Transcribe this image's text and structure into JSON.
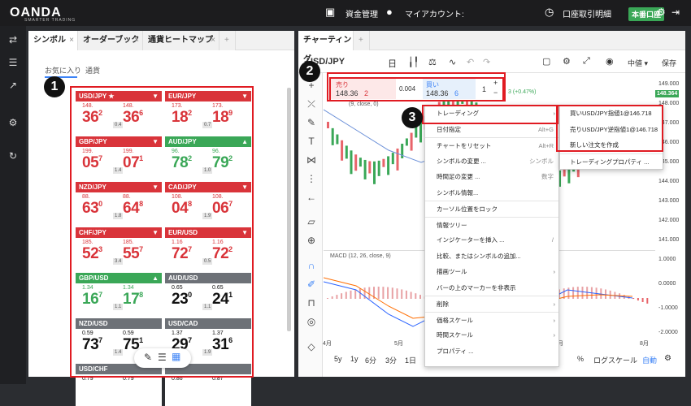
{
  "app": {
    "logo": "OANDA",
    "logo_sub": "SMARTER TRADING",
    "nav_funds": "資金管理",
    "nav_account": "マイアカウント:",
    "nav_statement": "口座取引明細",
    "badge": "本番口座"
  },
  "left_panel": {
    "tabs": [
      {
        "label": "シンボル"
      },
      {
        "label": "オーダーブック"
      },
      {
        "label": "通貨ヒートマップ"
      }
    ],
    "add_tab": "+",
    "subtabs": [
      "お気に入り",
      "通貨"
    ],
    "cards": [
      {
        "pair": "USD/JPY",
        "star": "★",
        "hdr": "r",
        "arrow": "▼",
        "bid_pre": "148.",
        "bid_big": "36",
        "bid_sup": "2",
        "ask_pre": "148.",
        "ask_big": "36",
        "ask_sup": "6",
        "spread": "0.4",
        "color": "cr"
      },
      {
        "pair": "EUR/JPY",
        "star": "",
        "hdr": "r",
        "arrow": "▼",
        "bid_pre": "173.",
        "bid_big": "18",
        "bid_sup": "2",
        "ask_pre": "173.",
        "ask_big": "18",
        "ask_sup": "9",
        "spread": "0.7",
        "color": "cr"
      },
      {
        "pair": "GBP/JPY",
        "star": "",
        "hdr": "r",
        "arrow": "▼",
        "bid_pre": "199.",
        "bid_big": "05",
        "bid_sup": "7",
        "ask_pre": "199.",
        "ask_big": "07",
        "ask_sup": "1",
        "spread": "1.4",
        "color": "cr"
      },
      {
        "pair": "AUD/JPY",
        "star": "",
        "hdr": "g",
        "arrow": "▲",
        "bid_pre": "96.",
        "bid_big": "78",
        "bid_sup": "2",
        "ask_pre": "96.",
        "ask_big": "79",
        "ask_sup": "2",
        "spread": "1.0",
        "color": "cg"
      },
      {
        "pair": "NZD/JPY",
        "star": "",
        "hdr": "r",
        "arrow": "▼",
        "bid_pre": "88.",
        "bid_big": "63",
        "bid_sup": "0",
        "ask_pre": "88.",
        "ask_big": "64",
        "ask_sup": "8",
        "spread": "1.8",
        "color": "cr"
      },
      {
        "pair": "CAD/JPY",
        "star": "",
        "hdr": "r",
        "arrow": "▼",
        "bid_pre": "108.",
        "bid_big": "04",
        "bid_sup": "8",
        "ask_pre": "108.",
        "ask_big": "06",
        "ask_sup": "7",
        "spread": "1.9",
        "color": "cr"
      },
      {
        "pair": "CHF/JPY",
        "star": "",
        "hdr": "r",
        "arrow": "▼",
        "bid_pre": "185.",
        "bid_big": "52",
        "bid_sup": "3",
        "ask_pre": "185.",
        "ask_big": "55",
        "ask_sup": "7",
        "spread": "3.4",
        "color": "cr"
      },
      {
        "pair": "EUR/USD",
        "star": "",
        "hdr": "r",
        "arrow": "▼",
        "bid_pre": "1.16",
        "bid_big": "72",
        "bid_sup": "7",
        "ask_pre": "1.16",
        "ask_big": "72",
        "ask_sup": "2",
        "spread": "0.5",
        "color": "cr"
      },
      {
        "pair": "GBP/USD",
        "star": "",
        "hdr": "g",
        "arrow": "▲",
        "bid_pre": "1.34",
        "bid_big": "16",
        "bid_sup": "7",
        "ask_pre": "1.34",
        "ask_big": "17",
        "ask_sup": "8",
        "spread": "1.1",
        "color": "cg"
      },
      {
        "pair": "AUD/USD",
        "star": "",
        "hdr": "gr",
        "arrow": "",
        "bid_pre": "0.65",
        "bid_big": "23",
        "bid_sup": "0",
        "ask_pre": "0.65",
        "ask_big": "24",
        "ask_sup": "1",
        "spread": "1.1",
        "color": "ck"
      },
      {
        "pair": "NZD/USD",
        "star": "",
        "hdr": "gr",
        "arrow": "",
        "bid_pre": "0.59",
        "bid_big": "73",
        "bid_sup": "7",
        "ask_pre": "0.59",
        "ask_big": "75",
        "ask_sup": "1",
        "spread": "1.4",
        "color": "ck"
      },
      {
        "pair": "USD/CAD",
        "star": "",
        "hdr": "gr",
        "arrow": "",
        "bid_pre": "1.37",
        "bid_big": "29",
        "bid_sup": "7",
        "ask_pre": "1.37",
        "ask_big": "31",
        "ask_sup": "6",
        "spread": "1.9",
        "color": "ck"
      },
      {
        "pair": "USD/CHF",
        "star": "",
        "hdr": "gr",
        "arrow": "",
        "bid_pre": "0.79",
        "bid_big": "",
        "bid_sup": "",
        "ask_pre": "0.79",
        "ask_big": "",
        "ask_sup": "",
        "spread": "",
        "color": "ck"
      },
      {
        "pair": "",
        "star": "",
        "hdr": "gr",
        "arrow": "",
        "bid_pre": "0.86",
        "bid_big": "",
        "bid_sup": "",
        "ask_pre": "0.87",
        "ask_big": "",
        "ask_sup": "",
        "spread": "",
        "color": "ck"
      }
    ]
  },
  "right_panel": {
    "tab": "チャーティング",
    "add_tab": "+",
    "symbol": "USD/JPY",
    "timeframe": "日",
    "price_type": "中値 ▾",
    "save": "保存",
    "trade": {
      "sell_label": "売り",
      "sell_price": "148.36",
      "sell_sup": "2",
      "spread": "0.004",
      "buy_label": "買い",
      "buy_price": "148.36",
      "buy_sup": "6",
      "qty": "1"
    },
    "change": "3 (+0.47%)",
    "legend": "(9, close, 0)",
    "macd_label": "MACD (12, 26, close, 9)",
    "price_ticks": [
      "149.000",
      "148.000",
      "147.000",
      "146.000",
      "145.000",
      "144.000",
      "143.000",
      "142.000",
      "141.000"
    ],
    "current_price": "148.364",
    "macd_ticks": [
      "1.0000",
      "0.0000",
      "-1.0000",
      "-2.0000"
    ],
    "x_ticks": [
      "4月",
      "5月",
      "6月",
      "7月",
      "8月"
    ],
    "bottom": [
      "5y",
      "1y",
      "6分",
      "3分",
      "1日"
    ],
    "bottom_right": [
      "%",
      "ログスケール",
      "自動"
    ]
  },
  "context_menu": {
    "items": [
      {
        "label": "トレーディング",
        "shortcut": "",
        "chev": "›"
      },
      {
        "label": "日付指定",
        "shortcut": "Alt+G",
        "chev": ""
      },
      {
        "label": "チャートをリセット",
        "shortcut": "Alt+R",
        "chev": ""
      },
      {
        "label": "シンボルの変更 ...",
        "shortcut": "シンボル",
        "chev": ""
      },
      {
        "label": "時間足の変更 ...",
        "shortcut": "数字",
        "chev": ""
      },
      {
        "label": "シンボル情報...",
        "shortcut": "",
        "chev": ""
      },
      {
        "label": "カーソル位置をロック",
        "shortcut": "",
        "chev": ""
      },
      {
        "label": "情報ツリー",
        "shortcut": "",
        "chev": ""
      },
      {
        "label": "インジケーターを挿入 ...",
        "shortcut": "/",
        "chev": ""
      },
      {
        "label": "比較、またはシンボルの追加...",
        "shortcut": "",
        "chev": ""
      },
      {
        "label": "描画ツール",
        "shortcut": "",
        "chev": "›"
      },
      {
        "label": "バーの上のマーカーを非表示",
        "shortcut": "",
        "chev": ""
      },
      {
        "label": "削除",
        "shortcut": "",
        "chev": "›"
      },
      {
        "label": "価格スケール",
        "shortcut": "",
        "chev": "›"
      },
      {
        "label": "時間スケール",
        "shortcut": "",
        "chev": "›"
      },
      {
        "label": "プロパティ ...",
        "shortcut": "",
        "chev": ""
      }
    ]
  },
  "submenu": {
    "items": [
      "買いUSD/JPY指値1@146.718",
      "売りUSD/JPY逆指値1@146.718",
      "新しい注文を作成",
      "トレーディングプロパティ ..."
    ]
  },
  "callouts": [
    "1",
    "2",
    "3"
  ]
}
